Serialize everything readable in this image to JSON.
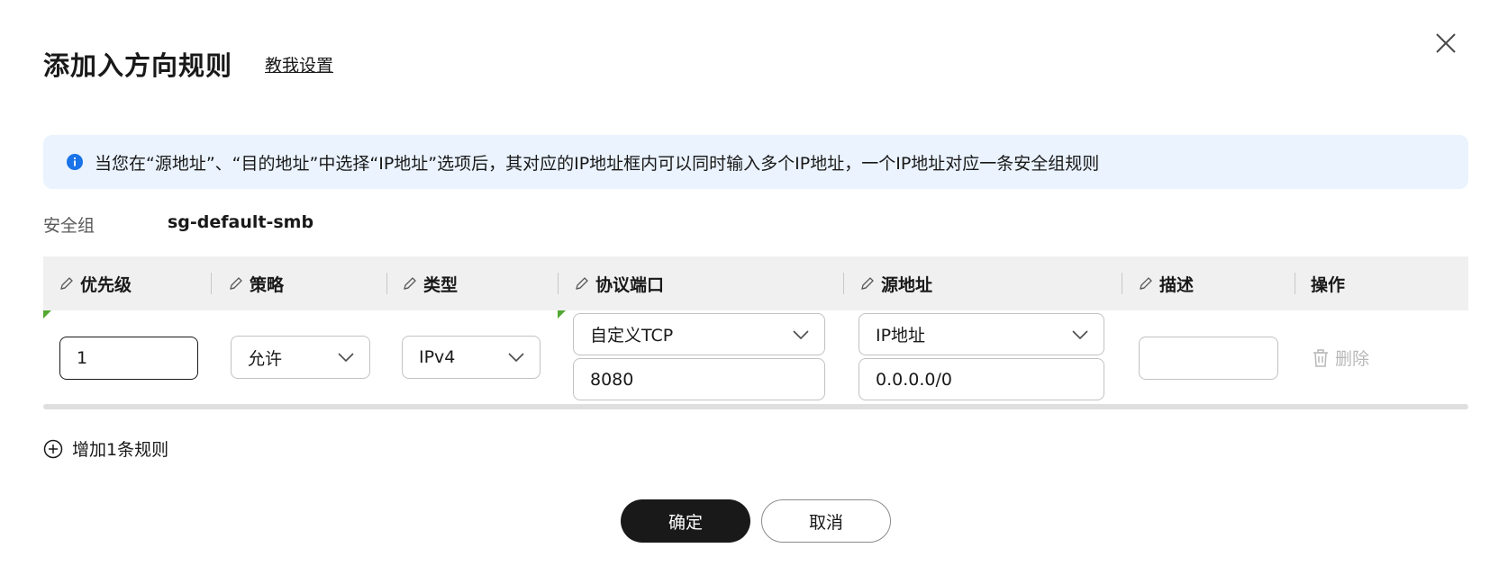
{
  "dialog": {
    "title": "添加入方向规则",
    "help_link": "教我设置"
  },
  "info": {
    "text": "当您在“源地址”、“目的地址”中选择“IP地址”选项后，其对应的IP地址框内可以同时输入多个IP地址，一个IP地址对应一条安全组规则"
  },
  "security_group": {
    "label": "安全组",
    "value": "sg-default-smb"
  },
  "table": {
    "headers": {
      "priority": "优先级",
      "policy": "策略",
      "type": "类型",
      "protocol_port": "协议端口",
      "source": "源地址",
      "description": "描述",
      "action": "操作"
    },
    "row": {
      "priority": "1",
      "policy": "允许",
      "type": "IPv4",
      "protocol": "自定义TCP",
      "port": "8080",
      "source_type": "IP地址",
      "source_address": "0.0.0.0/0",
      "description": "",
      "delete_label": "删除"
    }
  },
  "add_rule_label": "增加1条规则",
  "buttons": {
    "confirm": "确定",
    "cancel": "取消"
  },
  "colors": {
    "info_bg": "#eaf3fe",
    "info_icon": "#1a73e8",
    "primary_button": "#191919",
    "table_header_bg": "#f0f0f0",
    "marker_green": "#52a832"
  }
}
